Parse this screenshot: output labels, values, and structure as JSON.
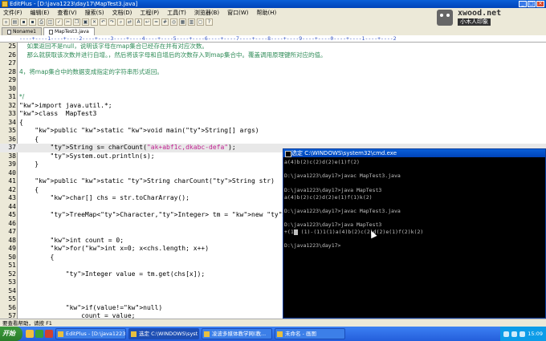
{
  "window": {
    "title": "EditPlus - [D:\\java1223\\day17\\MapTest3.java]"
  },
  "menu": [
    "文件(F)",
    "编辑(E)",
    "查看(V)",
    "搜索(S)",
    "文档(D)",
    "工程(P)",
    "工具(T)",
    "浏览器(B)",
    "窗口(W)",
    "帮助(H)"
  ],
  "logo": {
    "brand": "xwood.net",
    "cn": "小木人印象"
  },
  "tabs": [
    "Noname1",
    "MapTest3.java"
  ],
  "ruler": "----+----1----+----2----+----3----+----4----+----5----+----6----+----7----+----8----+----9----+----0----+----1----+----2",
  "code": [
    {
      "n": "25",
      "t": "    如果返回不是null，说明该字母在map集合已经存在并有对应次数。",
      "c": "cmt"
    },
    {
      "n": "26",
      "t": "    那么就获取该次数并进行自增。，然后将该字母和自增后的次数存入到map集合中。覆盖调用原理键所对应的值。",
      "c": "cmt"
    },
    {
      "n": "27",
      "t": "",
      "c": ""
    },
    {
      "n": "28",
      "t": "4，将map集合中的数据变成指定的字符串形式返回。",
      "c": "cmt"
    },
    {
      "n": "29",
      "t": "",
      "c": ""
    },
    {
      "n": "30",
      "t": "",
      "c": ""
    },
    {
      "n": "31",
      "t": "*/",
      "c": "cm"
    },
    {
      "n": "32",
      "t": "import java.util.*;",
      "c": "imp"
    },
    {
      "n": "33",
      "t": "class  MapTest3",
      "c": "cls"
    },
    {
      "n": "34",
      "t": "{",
      "c": ""
    },
    {
      "n": "35",
      "t": "    public static void main(String[] args)",
      "c": "main"
    },
    {
      "n": "36",
      "t": "    {",
      "c": ""
    },
    {
      "n": "37",
      "t": "        String s= charCount(\"ak+abf1c,dkabc-defa\");",
      "c": "str",
      "hl": true
    },
    {
      "n": "38",
      "t": "        System.out.println(s);",
      "c": "sys"
    },
    {
      "n": "39",
      "t": "    }",
      "c": ""
    },
    {
      "n": "40",
      "t": "",
      "c": ""
    },
    {
      "n": "41",
      "t": "    public static String charCount(String str)",
      "c": "cc"
    },
    {
      "n": "42",
      "t": "    {",
      "c": ""
    },
    {
      "n": "43",
      "t": "        char[] chs = str.toCharArray();",
      "c": "chs"
    },
    {
      "n": "44",
      "t": "",
      "c": ""
    },
    {
      "n": "45",
      "t": "        TreeMap<Character,Integer> tm = new TreeMap<Character,Integer>();",
      "c": "tm"
    },
    {
      "n": "46",
      "t": "",
      "c": ""
    },
    {
      "n": "47",
      "t": "",
      "c": ""
    },
    {
      "n": "48",
      "t": "        int count = 0;",
      "c": "int"
    },
    {
      "n": "49",
      "t": "        for(int x=0; x<chs.length; x++)",
      "c": "for"
    },
    {
      "n": "50",
      "t": "        {",
      "c": ""
    },
    {
      "n": "51",
      "t": "",
      "c": ""
    },
    {
      "n": "52",
      "t": "            Integer value = tm.get(chs[x]);",
      "c": "intg"
    },
    {
      "n": "53",
      "t": "",
      "c": ""
    },
    {
      "n": "54",
      "t": "",
      "c": ""
    },
    {
      "n": "55",
      "t": "",
      "c": ""
    },
    {
      "n": "56",
      "t": "            if(value!=null)",
      "c": "if"
    },
    {
      "n": "57",
      "t": "                count = value;",
      "c": ""
    }
  ],
  "cmd": {
    "title": "选定 C:\\WINDOWS\\system32\\cmd.exe",
    "lines": [
      "a(4)b(2)c(2)d(2)e(1)f(2)",
      "",
      "D:\\java1223\\day17>javac MapTest3.java",
      "",
      "D:\\java1223\\day17>java MapTest3",
      "a(4)b(2)c(2)d(2)e(1)f(1)k(2)",
      "",
      "D:\\java1223\\day17>javac MapTest3.java",
      "",
      "D:\\java1223\\day17>java MapTest3",
      "+(1) (1)-(1)1(1)a(4)b(2)c(2)d(2)e(1)f(2)k(2)",
      "",
      "D:\\java1223\\day17>"
    ]
  },
  "status": "要查看帮助，请按 F1",
  "taskbar": {
    "start": "开始",
    "buttons": [
      "EditPlus - [D:\\java1223\\...",
      "选定 C:\\WINDOWS\\syst...",
      "凌波多媒体教学网(教...",
      "未命名 - 画图"
    ],
    "clock": "15:09"
  }
}
